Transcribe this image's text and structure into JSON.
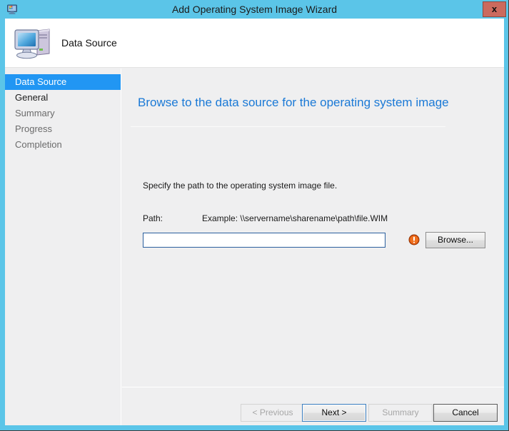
{
  "window": {
    "title": "Add Operating System Image Wizard",
    "close_label": "x",
    "titlebar_icon": "wizard-monitor-icon",
    "accent_color": "#5bc5e8",
    "close_button_color": "#cb6a5e"
  },
  "header": {
    "icon": "computer-monitor-icon",
    "title": "Data Source"
  },
  "sidebar": {
    "items": [
      {
        "label": "Data Source",
        "state": "selected"
      },
      {
        "label": "General",
        "state": "done"
      },
      {
        "label": "Summary",
        "state": "normal"
      },
      {
        "label": "Progress",
        "state": "normal"
      },
      {
        "label": "Completion",
        "state": "normal"
      }
    ],
    "selected_color": "#2196f3"
  },
  "content": {
    "heading": "Browse to the data source for the operating system image",
    "heading_color": "#1a79d6",
    "instruction": "Specify the path to the operating system image file.",
    "path_label": "Path:",
    "path_example": "Example: \\\\servername\\sharename\\path\\file.WIM",
    "path_value": "",
    "path_placeholder": "",
    "error_icon": "error-exclamation-icon",
    "error_color": "#e2570f",
    "browse_label": "Browse..."
  },
  "footer": {
    "previous_label": "< Previous",
    "next_label": "Next >",
    "summary_label": "Summary",
    "cancel_label": "Cancel"
  }
}
